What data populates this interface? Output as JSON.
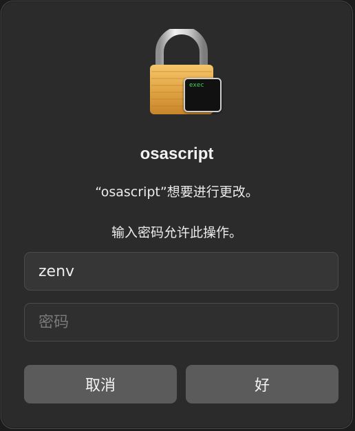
{
  "dialog": {
    "app_name": "osascript",
    "message": "“osascript”想要进行更改。",
    "prompt": "输入密码允许此操作。",
    "username_value": "zenv",
    "password_placeholder": "密码",
    "cancel_label": "取消",
    "ok_label": "好",
    "badge_text": "exec"
  },
  "colors": {
    "dialog_bg": "#2b2b2b",
    "button_bg": "#5b5b5b",
    "lock_gold": "#e0a84a",
    "terminal_green": "#3fd45a"
  },
  "icons": {
    "lock": "padlock-icon",
    "badge": "terminal-exec-icon"
  }
}
